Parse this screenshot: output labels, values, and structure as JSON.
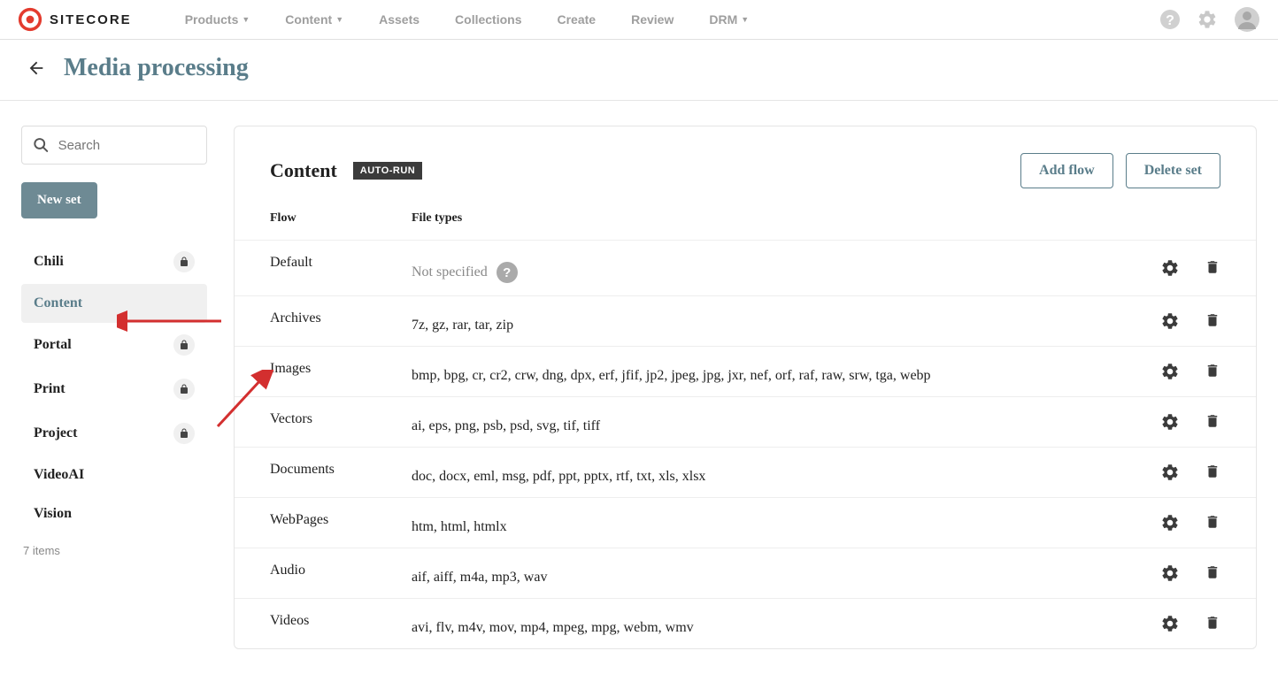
{
  "brand": "SITECORE",
  "nav": [
    {
      "label": "Products",
      "dropdown": true
    },
    {
      "label": "Content",
      "dropdown": true
    },
    {
      "label": "Assets",
      "dropdown": false
    },
    {
      "label": "Collections",
      "dropdown": false
    },
    {
      "label": "Create",
      "dropdown": false
    },
    {
      "label": "Review",
      "dropdown": false
    },
    {
      "label": "DRM",
      "dropdown": true
    }
  ],
  "page_title": "Media processing",
  "search_placeholder": "Search",
  "new_set_label": "New set",
  "sidebar_items": [
    {
      "label": "Chili",
      "locked": true,
      "active": false
    },
    {
      "label": "Content",
      "locked": false,
      "active": true
    },
    {
      "label": "Portal",
      "locked": true,
      "active": false
    },
    {
      "label": "Print",
      "locked": true,
      "active": false
    },
    {
      "label": "Project",
      "locked": true,
      "active": false
    },
    {
      "label": "VideoAI",
      "locked": false,
      "active": false
    },
    {
      "label": "Vision",
      "locked": false,
      "active": false
    }
  ],
  "item_count_label": "7 items",
  "panel": {
    "title": "Content",
    "badge": "AUTO-RUN",
    "add_flow_label": "Add flow",
    "delete_set_label": "Delete set",
    "columns": {
      "flow": "Flow",
      "types": "File types"
    },
    "not_specified": "Not specified",
    "rows": [
      {
        "flow": "Default",
        "types": "",
        "unspecified": true
      },
      {
        "flow": "Archives",
        "types": "7z, gz, rar, tar, zip"
      },
      {
        "flow": "Images",
        "types": "bmp, bpg, cr, cr2, crw, dng, dpx, erf, jfif, jp2, jpeg, jpg, jxr, nef, orf, raf, raw, srw, tga, webp"
      },
      {
        "flow": "Vectors",
        "types": "ai, eps, png, psb, psd, svg, tif, tiff"
      },
      {
        "flow": "Documents",
        "types": "doc, docx, eml, msg, pdf, ppt, pptx, rtf, txt, xls, xlsx"
      },
      {
        "flow": "WebPages",
        "types": "htm, html, htmlx"
      },
      {
        "flow": "Audio",
        "types": "aif, aiff, m4a, mp3, wav"
      },
      {
        "flow": "Videos",
        "types": "avi, flv, m4v, mov, mp4, mpeg, mpg, webm, wmv"
      }
    ]
  }
}
